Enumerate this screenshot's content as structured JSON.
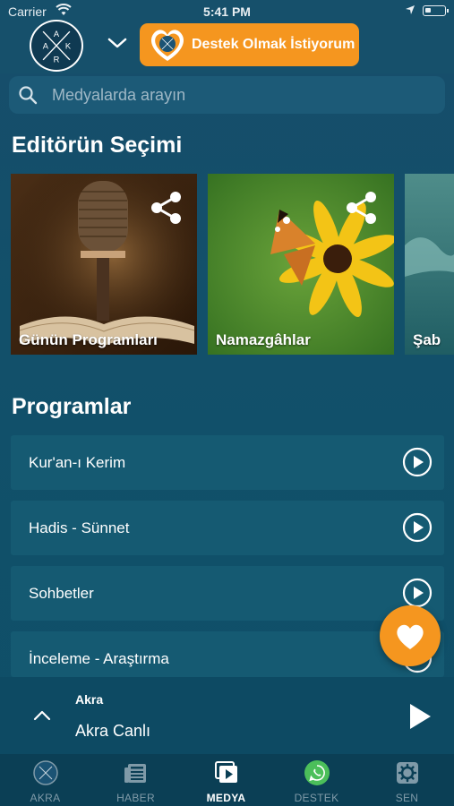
{
  "status_bar": {
    "carrier": "Carrier",
    "time": "5:41 PM"
  },
  "header": {
    "logo_letters": [
      "A",
      "K",
      "R"
    ],
    "support_button": "Destek Olmak İstiyorum"
  },
  "search": {
    "placeholder": "Medyalarda arayın"
  },
  "editor": {
    "title": "Editörün Seçimi",
    "cards": [
      {
        "caption": "Günün Programları"
      },
      {
        "caption": "Namazgâhlar"
      },
      {
        "caption": "Şab"
      }
    ]
  },
  "programs": {
    "title": "Programlar",
    "items": [
      {
        "label": "Kur'an-ı Kerim"
      },
      {
        "label": "Hadis - Sünnet"
      },
      {
        "label": "Sohbetler"
      },
      {
        "label": "İnceleme - Araştırma"
      }
    ]
  },
  "player": {
    "station": "Akra",
    "track": "Akra Canlı"
  },
  "tabs": [
    {
      "label": "AKRA",
      "icon": "akra-logo-icon",
      "active": false
    },
    {
      "label": "HABER",
      "icon": "newspaper-icon",
      "active": false
    },
    {
      "label": "MEDYA",
      "icon": "media-play-icon",
      "active": true
    },
    {
      "label": "DESTEK",
      "icon": "whatsapp-icon",
      "active": false
    },
    {
      "label": "SEN",
      "icon": "gear-icon",
      "active": false
    }
  ],
  "colors": {
    "accent": "#f5961f",
    "background": "#12506a",
    "header": "#16506b",
    "tabbar": "#0b3f55"
  }
}
